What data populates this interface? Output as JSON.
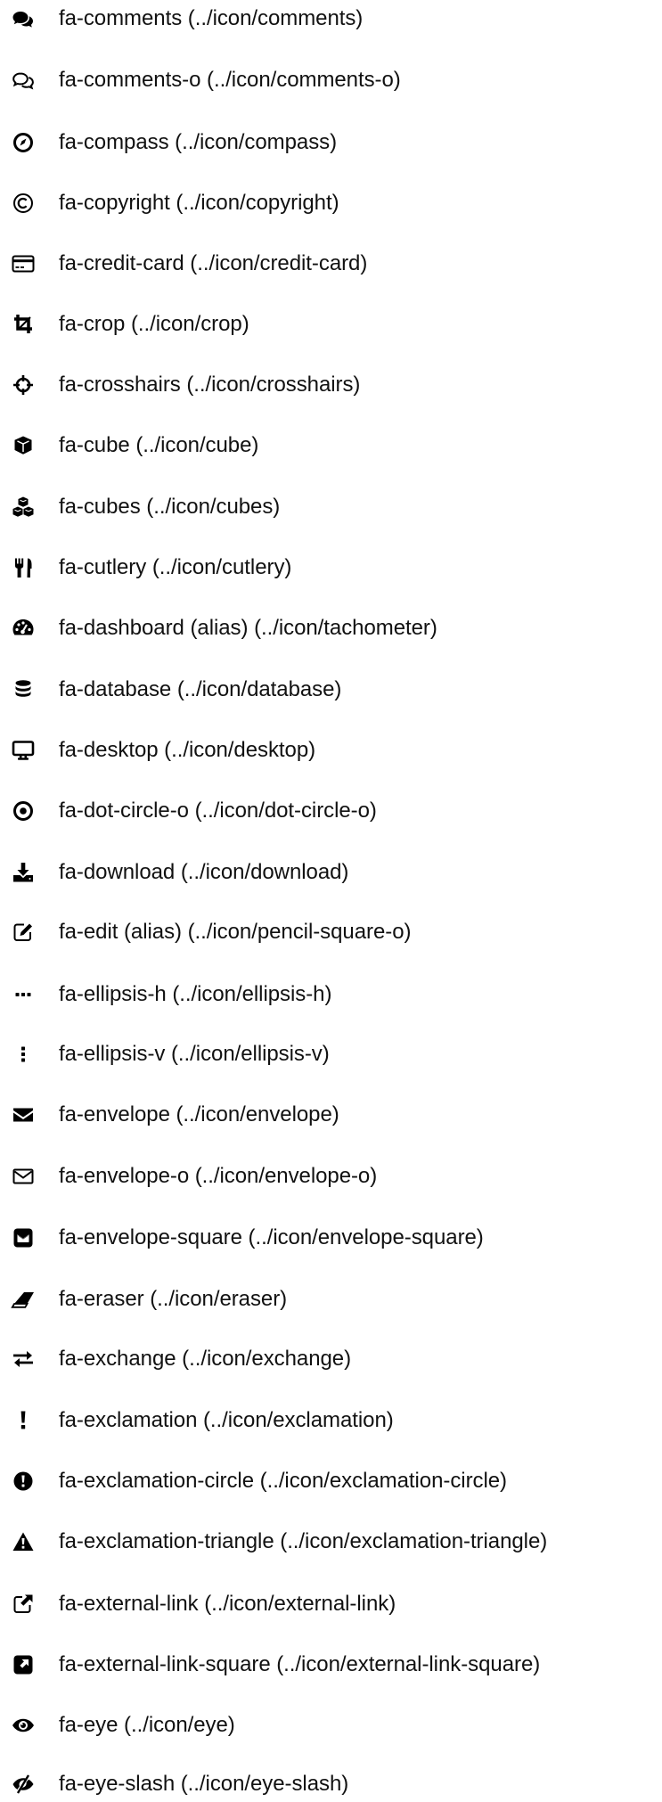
{
  "icons": [
    {
      "icon": "comments-icon",
      "label": "fa-comments (../icon/comments)"
    },
    {
      "icon": "comments-o-icon",
      "label": "fa-comments-o (../icon/comments-o)"
    },
    {
      "icon": "compass-icon",
      "label": "fa-compass (../icon/compass)"
    },
    {
      "icon": "copyright-icon",
      "label": "fa-copyright (../icon/copyright)"
    },
    {
      "icon": "credit-card-icon",
      "label": "fa-credit-card (../icon/credit-card)"
    },
    {
      "icon": "crop-icon",
      "label": "fa-crop (../icon/crop)"
    },
    {
      "icon": "crosshairs-icon",
      "label": "fa-crosshairs (../icon/crosshairs)"
    },
    {
      "icon": "cube-icon",
      "label": "fa-cube (../icon/cube)"
    },
    {
      "icon": "cubes-icon",
      "label": "fa-cubes (../icon/cubes)"
    },
    {
      "icon": "cutlery-icon",
      "label": "fa-cutlery (../icon/cutlery)"
    },
    {
      "icon": "dashboard-icon",
      "label": "fa-dashboard (alias) (../icon/tachometer)"
    },
    {
      "icon": "database-icon",
      "label": "fa-database (../icon/database)"
    },
    {
      "icon": "desktop-icon",
      "label": "fa-desktop (../icon/desktop)"
    },
    {
      "icon": "dot-circle-o-icon",
      "label": "fa-dot-circle-o (../icon/dot-circle-o)"
    },
    {
      "icon": "download-icon",
      "label": "fa-download (../icon/download)"
    },
    {
      "icon": "edit-icon",
      "label": "fa-edit (alias) (../icon/pencil-square-o)"
    },
    {
      "icon": "ellipsis-h-icon",
      "label": "fa-ellipsis-h (../icon/ellipsis-h)"
    },
    {
      "icon": "ellipsis-v-icon",
      "label": "fa-ellipsis-v (../icon/ellipsis-v)"
    },
    {
      "icon": "envelope-icon",
      "label": "fa-envelope (../icon/envelope)"
    },
    {
      "icon": "envelope-o-icon",
      "label": "fa-envelope-o (../icon/envelope-o)"
    },
    {
      "icon": "envelope-square-icon",
      "label": "fa-envelope-square (../icon/envelope-square)"
    },
    {
      "icon": "eraser-icon",
      "label": "fa-eraser (../icon/eraser)"
    },
    {
      "icon": "exchange-icon",
      "label": "fa-exchange (../icon/exchange)"
    },
    {
      "icon": "exclamation-icon",
      "label": "fa-exclamation (../icon/exclamation)"
    },
    {
      "icon": "exclamation-circle-icon",
      "label": "fa-exclamation-circle (../icon/exclamation-circle)"
    },
    {
      "icon": "exclamation-triangle-icon",
      "label": "fa-exclamation-triangle (../icon/exclamation-triangle)"
    },
    {
      "icon": "external-link-icon",
      "label": "fa-external-link (../icon/external-link)"
    },
    {
      "icon": "external-link-square-icon",
      "label": "fa-external-link-square (../icon/external-link-square)"
    },
    {
      "icon": "eye-icon",
      "label": "fa-eye (../icon/eye)"
    },
    {
      "icon": "eye-slash-icon",
      "label": "fa-eye-slash (../icon/eye-slash)"
    }
  ]
}
